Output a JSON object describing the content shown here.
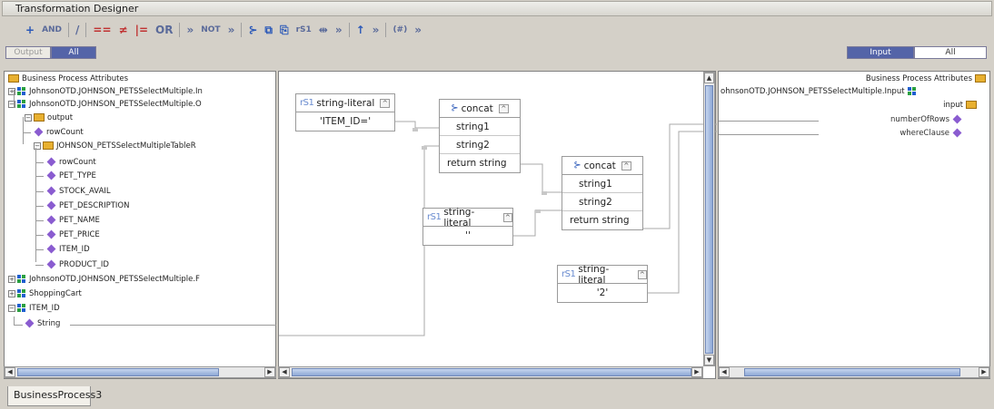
{
  "window": {
    "title": "Transformation Designer"
  },
  "toolbar": [
    {
      "icon": "add-icon",
      "text": "+"
    },
    {
      "icon": "and-operator",
      "text": "AND"
    },
    {
      "icon": "divide-icon",
      "text": "/"
    },
    {
      "icon": "equals-icon",
      "text": "=="
    },
    {
      "icon": "not-equals-icon",
      "text": "≠"
    },
    {
      "icon": "less-equal-icon",
      "text": "|="
    },
    {
      "icon": "or-operator",
      "text": "OR"
    },
    {
      "icon": "more-menu",
      "text": "»"
    },
    {
      "icon": "not-operator",
      "text": "NOT"
    },
    {
      "icon": "more-menu",
      "text": "»"
    },
    {
      "icon": "concat-icon",
      "text": "⊱"
    },
    {
      "icon": "copy-icon",
      "text": "⧉"
    },
    {
      "icon": "paste-icon",
      "text": "⎘"
    },
    {
      "icon": "string-literal-icon",
      "text": "rS1"
    },
    {
      "icon": "link-icon",
      "text": "⇹"
    },
    {
      "icon": "more-menu",
      "text": "»"
    },
    {
      "icon": "up-arrow-icon",
      "text": "↑"
    },
    {
      "icon": "more-menu",
      "text": "»"
    },
    {
      "icon": "decimal-icon",
      "text": "(#)"
    },
    {
      "icon": "more-menu",
      "text": "»"
    }
  ],
  "left_tabs": {
    "output": "Output",
    "all": "All"
  },
  "right_tabs": {
    "input": "Input",
    "all": "All"
  },
  "left_tree": [
    {
      "label": "Business Process Attributes",
      "level": 0,
      "icon": "folder"
    },
    {
      "label": "JohnsonOTD.JOHNSON_PETSSelectMultiple.In",
      "level": 0,
      "icon": "biz"
    },
    {
      "label": "JohnsonOTD.JOHNSON_PETSSelectMultiple.O",
      "level": 0,
      "icon": "biz"
    },
    {
      "label": "output",
      "level": 1,
      "icon": "folder"
    },
    {
      "label": "rowCount",
      "level": 2,
      "icon": "diamond"
    },
    {
      "label": "JOHNSON_PETSSelectMultipleTableR",
      "level": 2,
      "icon": "folder"
    },
    {
      "label": "rowCount",
      "level": 3,
      "icon": "diamond"
    },
    {
      "label": "PET_TYPE",
      "level": 3,
      "icon": "diamond"
    },
    {
      "label": "STOCK_AVAIL",
      "level": 3,
      "icon": "diamond"
    },
    {
      "label": "PET_DESCRIPTION",
      "level": 3,
      "icon": "diamond"
    },
    {
      "label": "PET_NAME",
      "level": 3,
      "icon": "diamond"
    },
    {
      "label": "PET_PRICE",
      "level": 3,
      "icon": "diamond"
    },
    {
      "label": "ITEM_ID",
      "level": 3,
      "icon": "diamond"
    },
    {
      "label": "PRODUCT_ID",
      "level": 3,
      "icon": "diamond"
    },
    {
      "label": "JohnsonOTD.JOHNSON_PETSSelectMultiple.F",
      "level": 0,
      "icon": "biz"
    },
    {
      "label": "ShoppingCart",
      "level": 0,
      "icon": "biz"
    },
    {
      "label": "ITEM_ID",
      "level": 0,
      "icon": "biz"
    },
    {
      "label": "String",
      "level": 1,
      "icon": "diamond"
    }
  ],
  "right_tree": [
    {
      "label": "Business Process Attributes"
    },
    {
      "label": "ohnsonOTD.JOHNSON_PETSSelectMultiple.Input"
    },
    {
      "label": "input"
    },
    {
      "label": "numberOfRows"
    },
    {
      "label": "whereClause"
    }
  ],
  "nodes": {
    "lit1": {
      "tag": "rS1",
      "title": "string-literal",
      "value": "'ITEM_ID='"
    },
    "concat1": {
      "title": "concat",
      "inputs": [
        "string1",
        "string2"
      ],
      "output": "return string"
    },
    "lit2": {
      "tag": "rS1",
      "title": "string-literal",
      "value": "''"
    },
    "concat2": {
      "title": "concat",
      "inputs": [
        "string1",
        "string2"
      ],
      "output": "return string"
    },
    "lit3": {
      "tag": "rS1",
      "title": "string-literal",
      "value": "'2'"
    }
  },
  "bottom_tab": "BusinessProcess3"
}
